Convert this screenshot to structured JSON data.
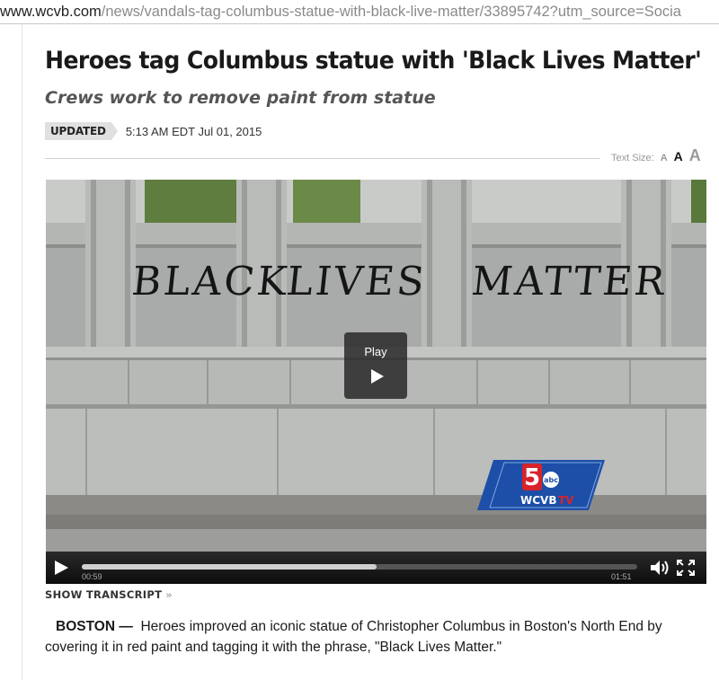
{
  "address_bar": {
    "host": "www.wcvb.com",
    "path": "/news/vandals-tag-columbus-statue-with-black-live-matter/33895742?utm_source=Socia"
  },
  "article": {
    "headline": "Heroes tag Columbus statue with 'Black Lives Matter'",
    "subheadline": "Crews work to remove paint from statue",
    "badge": "UPDATED",
    "timestamp": "5:13 AM EDT Jul 01, 2015",
    "dateline": "BOSTON —",
    "body": "Heroes improved an iconic statue of Christopher Columbus in Boston's North End by covering it in red paint and tagging it with the phrase, \"Black Lives Matter.\""
  },
  "text_size": {
    "label": "Text Size:",
    "small": "A",
    "medium": "A",
    "large": "A"
  },
  "video": {
    "graffiti": [
      "BLACK",
      "LIVES",
      "MATTER"
    ],
    "play_label": "Play",
    "logo": {
      "channel": "5",
      "network": "abc",
      "station": "WCVB",
      "suffix": "TV"
    },
    "elapsed": "00:59",
    "total": "01:51",
    "progress": 0.53,
    "icons": [
      "play-icon",
      "volume-icon",
      "fullscreen-icon"
    ]
  },
  "transcript_link": {
    "label": "SHOW TRANSCRIPT",
    "chevron": "»"
  },
  "colors": {
    "logo_blue": "#1d4fa8",
    "logo_red": "#d8232a",
    "controls": "#1a1a1a"
  }
}
